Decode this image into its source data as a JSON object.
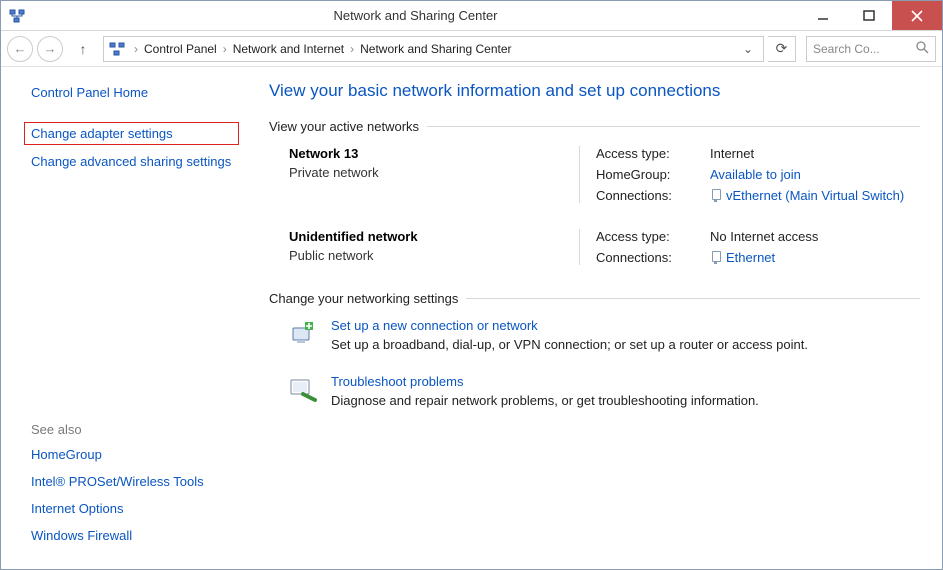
{
  "titlebar": {
    "title": "Network and Sharing Center"
  },
  "breadcrumb": {
    "items": [
      "Control Panel",
      "Network and Internet",
      "Network and Sharing Center"
    ]
  },
  "search": {
    "placeholder": "Search Co..."
  },
  "sidebar": {
    "home": "Control Panel Home",
    "links": {
      "adapter": "Change adapter settings",
      "advanced": "Change advanced sharing settings"
    },
    "see_also_header": "See also",
    "see_also": {
      "homegroup": "HomeGroup",
      "proset": "Intel® PROSet/Wireless Tools",
      "inetopt": "Internet Options",
      "firewall": "Windows Firewall"
    }
  },
  "main": {
    "heading": "View your basic network information and set up connections",
    "active_header": "View your active networks",
    "networks": [
      {
        "name": "Network  13",
        "type": "Private network",
        "access_label": "Access type:",
        "access_value": "Internet",
        "homegroup_label": "HomeGroup:",
        "homegroup_value": "Available to join",
        "conn_label": "Connections:",
        "conn_value": "vEthernet (Main Virtual Switch)"
      },
      {
        "name": "Unidentified network",
        "type": "Public network",
        "access_label": "Access type:",
        "access_value": "No Internet access",
        "conn_label": "Connections:",
        "conn_value": "Ethernet"
      }
    ],
    "change_header": "Change your networking settings",
    "actions": [
      {
        "title": "Set up a new connection or network",
        "desc": "Set up a broadband, dial-up, or VPN connection; or set up a router or access point."
      },
      {
        "title": "Troubleshoot problems",
        "desc": "Diagnose and repair network problems, or get troubleshooting information."
      }
    ]
  }
}
